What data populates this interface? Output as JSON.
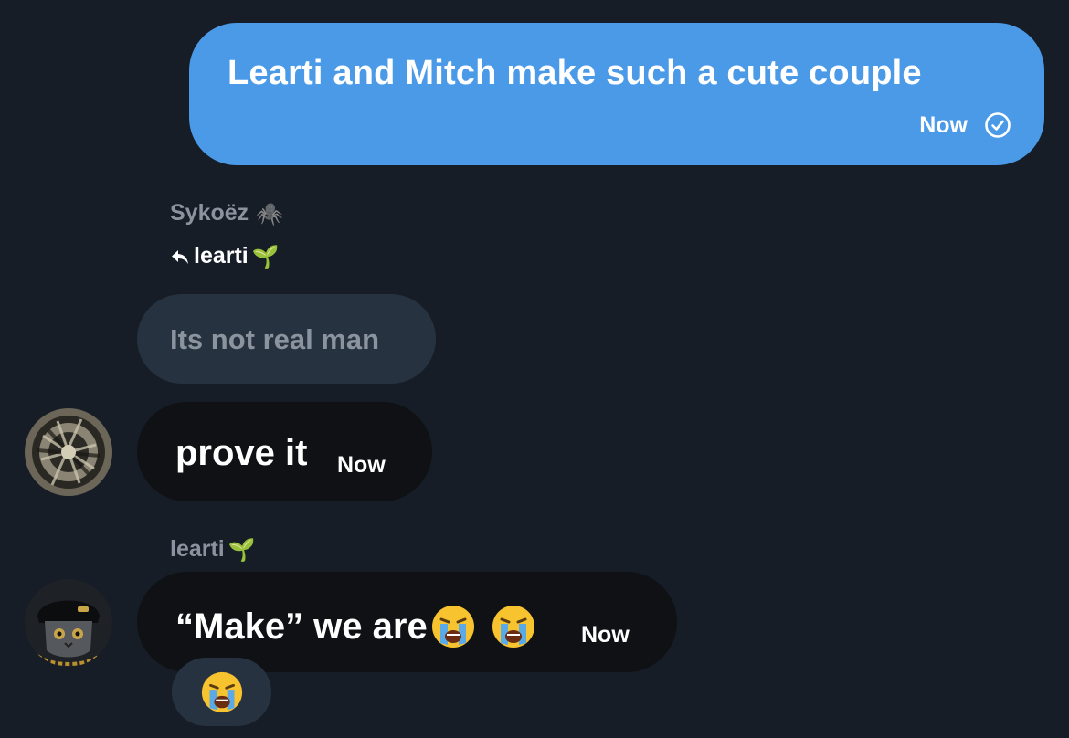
{
  "outgoing": {
    "text": "Learti and Mitch make such a cute couple",
    "time": "Now",
    "status_icon": "check-circle-icon",
    "bubble_color": "#4a9ae8"
  },
  "reply_group": {
    "sender": "Sykoëz",
    "sender_emoji": "🕷️",
    "reply_to": "learti",
    "reply_to_emoji": "🌱",
    "quoted_text": "Its not real man",
    "message": "prove it",
    "time": "Now"
  },
  "second_group": {
    "sender": "learti",
    "sender_emoji": "🌱",
    "message": "“Make” we are",
    "time": "Now",
    "reaction": "😭"
  },
  "colors": {
    "background": "#161d27",
    "incoming_bubble": "#0f1114",
    "quote_bubble": "#273240",
    "muted_text": "#8b939e"
  }
}
